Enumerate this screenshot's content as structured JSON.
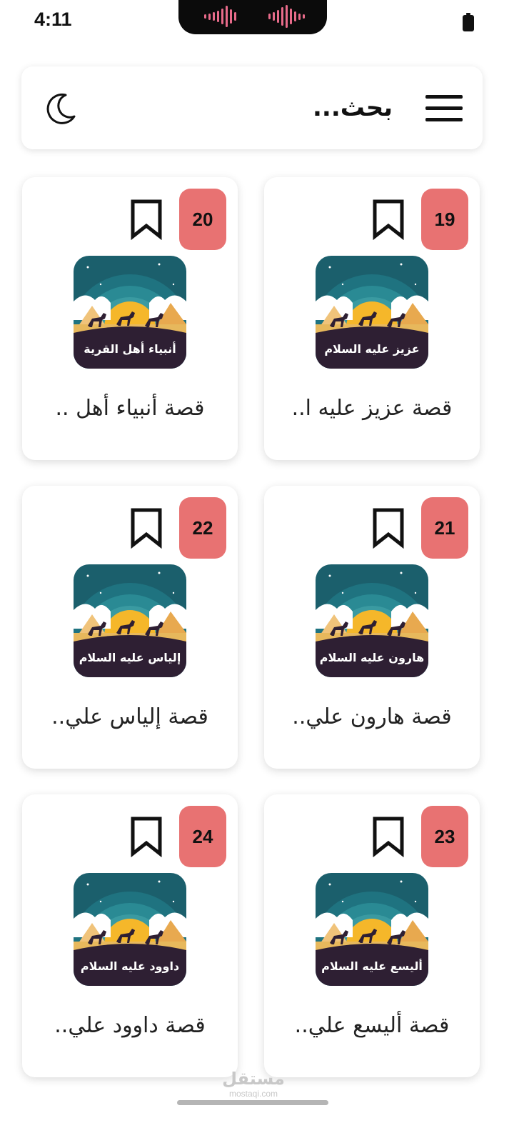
{
  "status_bar": {
    "time": "4:11"
  },
  "header": {
    "search_placeholder": "بحث..."
  },
  "cards": [
    {
      "number": "19",
      "title": "قصة عزيز عليه ا..",
      "thumb_label": "عزيز عليه السلام"
    },
    {
      "number": "20",
      "title": "قصة أنبياء أهل ..",
      "thumb_label": "أنبياء أهل القرية"
    },
    {
      "number": "21",
      "title": "قصة هارون علي..",
      "thumb_label": "هارون عليه السلام"
    },
    {
      "number": "22",
      "title": "قصة إلياس علي..",
      "thumb_label": "إلياس عليه السلام"
    },
    {
      "number": "23",
      "title": "قصة أليسع علي..",
      "thumb_label": "أليسع عليه السلام"
    },
    {
      "number": "24",
      "title": "قصة داوود علي..",
      "thumb_label": "داوود عليه السلام"
    }
  ],
  "watermark": {
    "arabic": "مستقل",
    "latin": "mostaqi.com"
  },
  "colors": {
    "badge": "#e87272",
    "thumb_sky": "#1f6e78",
    "thumb_ground": "#2e1f33",
    "sun": "#f5b72a"
  }
}
